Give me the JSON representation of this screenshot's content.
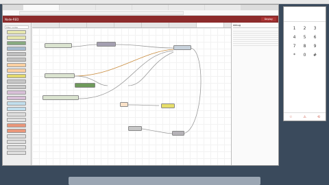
{
  "browser": {
    "tabs": [
      "",
      "",
      "",
      "",
      "",
      "",
      ""
    ],
    "url": "",
    "app_title": "Node-RED",
    "deploy_label": "Deploy"
  },
  "palette": {
    "filter_placeholder": "filter nodes"
  },
  "flow": {
    "tabs": [
      "",
      "",
      "",
      "",
      "",
      "",
      "",
      ""
    ]
  },
  "debug": {
    "title": "debug",
    "entries": [
      {
        "meta": "",
        "text": ""
      },
      {
        "meta": "",
        "text": ""
      },
      {
        "meta": "",
        "text": ""
      },
      {
        "meta": "",
        "text": ""
      },
      {
        "meta": "",
        "text": ""
      },
      {
        "meta": "",
        "text": ""
      },
      {
        "meta": "",
        "text": ""
      },
      {
        "meta": "",
        "text": ""
      }
    ]
  },
  "phone": {
    "name": "",
    "status": "",
    "keys": [
      "1",
      "2",
      "3",
      "4",
      "5",
      "6",
      "7",
      "8",
      "9",
      "*",
      "0",
      "#"
    ],
    "brand": ""
  },
  "colors": {
    "header": "#8c2b2b",
    "deploy": "#aa3333"
  }
}
